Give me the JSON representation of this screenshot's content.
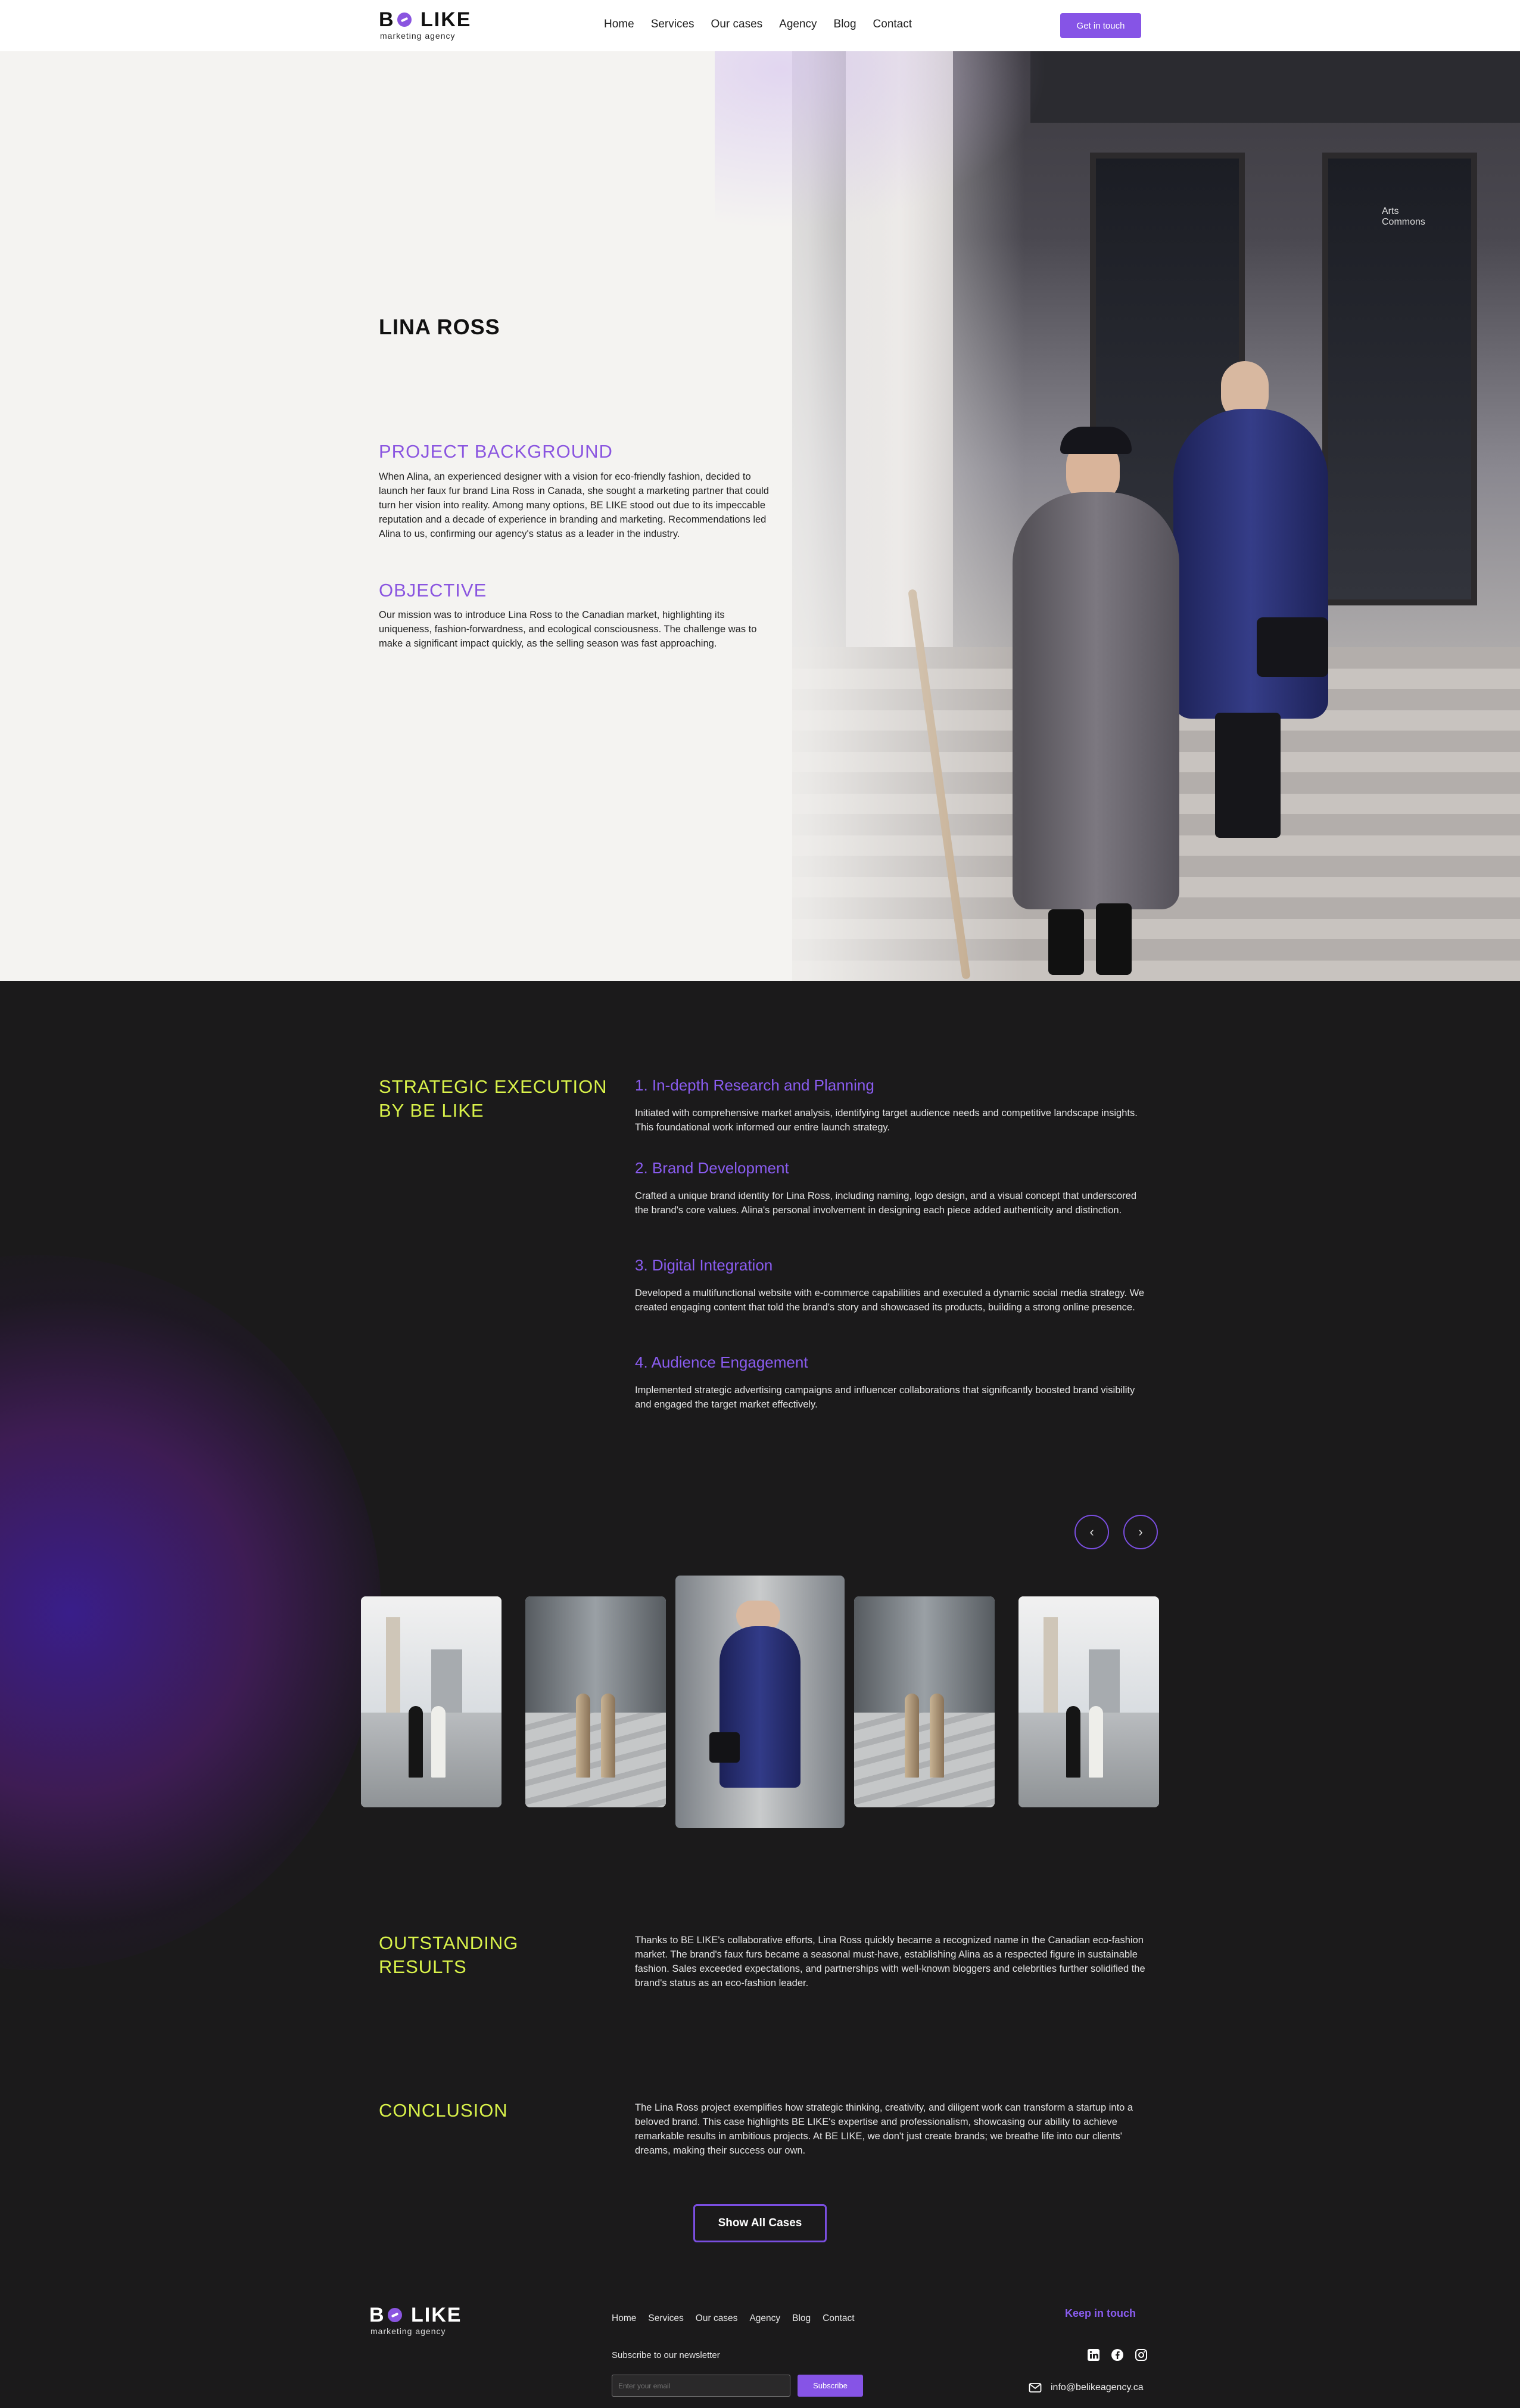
{
  "header": {
    "logo": {
      "main": "BE LIKE",
      "sub": "marketing agency"
    },
    "nav": [
      "Home",
      "Services",
      "Our cases",
      "Agency",
      "Blog",
      "Contact"
    ],
    "cta": "Get in touch"
  },
  "hero": {
    "title": "LINA ROSS",
    "background_heading": "PROJECT BACKGROUND",
    "background_text": "When Alina, an experienced designer with a vision for eco-friendly fashion, decided to launch her faux fur brand Lina Ross in Canada, she sought a marketing partner that could turn her vision into reality. Among many options, BE LIKE stood out due to its impeccable reputation and a decade of experience in branding and marketing. Recommendations led Alina to us, confirming our agency's status as a leader in the industry.",
    "objective_heading": "OBJECTIVE",
    "objective_text": "Our mission was to introduce Lina Ross to the Canadian market, highlighting its uniqueness, fashion-forwardness, and ecological consciousness. The challenge was to make a significant impact quickly, as the selling season was fast approaching.",
    "door_sign": "Arts Commons"
  },
  "strategy": {
    "heading": "STRATEGIC EXECUTION BY BE LIKE",
    "steps": [
      {
        "title": "1.  In-depth Research and Planning",
        "text": "Initiated with comprehensive market analysis, identifying target audience needs and competitive landscape insights. This foundational work informed our entire launch strategy."
      },
      {
        "title": "2. Brand Development",
        "text": "Crafted a unique brand identity for Lina Ross, including naming, logo design, and a visual concept that underscored the brand's core values. Alina's personal involvement in designing each piece added authenticity and distinction."
      },
      {
        "title": "3. Digital Integration",
        "text": "Developed a multifunctional website with e-commerce capabilities and executed a dynamic social media strategy. We created engaging content that told the brand's story and showcased its products, building a strong online presence."
      },
      {
        "title": "4. Audience Engagement",
        "text": "Implemented strategic advertising campaigns and influencer collaborations that significantly boosted brand visibility and engaged the target market effectively."
      }
    ]
  },
  "gallery": {
    "prev_icon": "‹",
    "next_icon": "›",
    "items": [
      "city-photo-1",
      "street-photo-1",
      "center-photo",
      "street-photo-2",
      "city-photo-2"
    ]
  },
  "results": {
    "heading": "OUTSTANDING RESULTS",
    "text": "Thanks to BE LIKE's collaborative efforts, Lina Ross quickly became a recognized name in the Canadian eco-fashion market. The brand's faux furs became a seasonal must-have, establishing Alina as a respected figure in sustainable fashion. Sales exceeded expectations, and partnerships with well-known bloggers and celebrities further solidified the brand's status as an eco-fashion leader."
  },
  "conclusion": {
    "heading": "CONCLUSION",
    "text": "The Lina Ross project exemplifies how strategic thinking, creativity, and diligent work can transform a startup into a beloved brand. This case highlights BE LIKE's expertise and professionalism, showcasing our ability to achieve remarkable results in ambitious projects. At BE LIKE, we don't just create brands; we breathe life into our clients' dreams, making their success our own."
  },
  "show_all": "Show All Cases",
  "footer": {
    "logo": {
      "main": "BE LIKE",
      "sub": "marketing agency"
    },
    "nav": [
      "Home",
      "Services",
      "Our cases",
      "Agency",
      "Blog",
      "Contact"
    ],
    "keep_in_touch": "Keep in touch",
    "subscribe_label": "Subscribe to our newsletter",
    "email_placeholder": "Enter your email",
    "subscribe_btn": "Subscribe",
    "email": "info@belikeagency.ca"
  },
  "colors": {
    "accent": "#8654e6",
    "heading_purple": "#8a55e0",
    "lime": "#d9f24a",
    "dark_bg": "#1b1a1b"
  }
}
